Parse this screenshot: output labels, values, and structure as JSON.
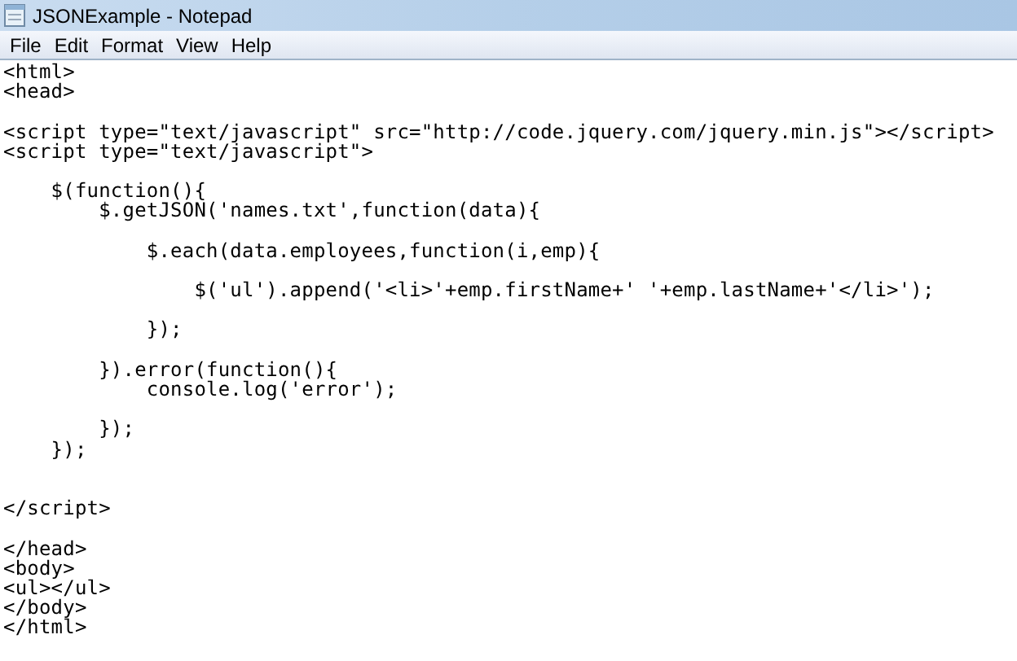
{
  "window": {
    "title": "JSONExample - Notepad"
  },
  "menu": [
    {
      "label": "File"
    },
    {
      "label": "Edit"
    },
    {
      "label": "Format"
    },
    {
      "label": "View"
    },
    {
      "label": "Help"
    }
  ],
  "editor": {
    "text": "<html>\n<head>\n\n<script type=\"text/javascript\" src=\"http://code.jquery.com/jquery.min.js\"></script>\n<script type=\"text/javascript\">\n\n    $(function(){\n        $.getJSON('names.txt',function(data){\n\n            $.each(data.employees,function(i,emp){\n\n                $('ul').append('<li>'+emp.firstName+' '+emp.lastName+'</li>');\n\n            });\n\n        }).error(function(){\n            console.log('error');\n\n        });\n    });\n\n\n</script>\n\n</head>\n<body>\n<ul></ul>\n</body>\n</html>"
  }
}
